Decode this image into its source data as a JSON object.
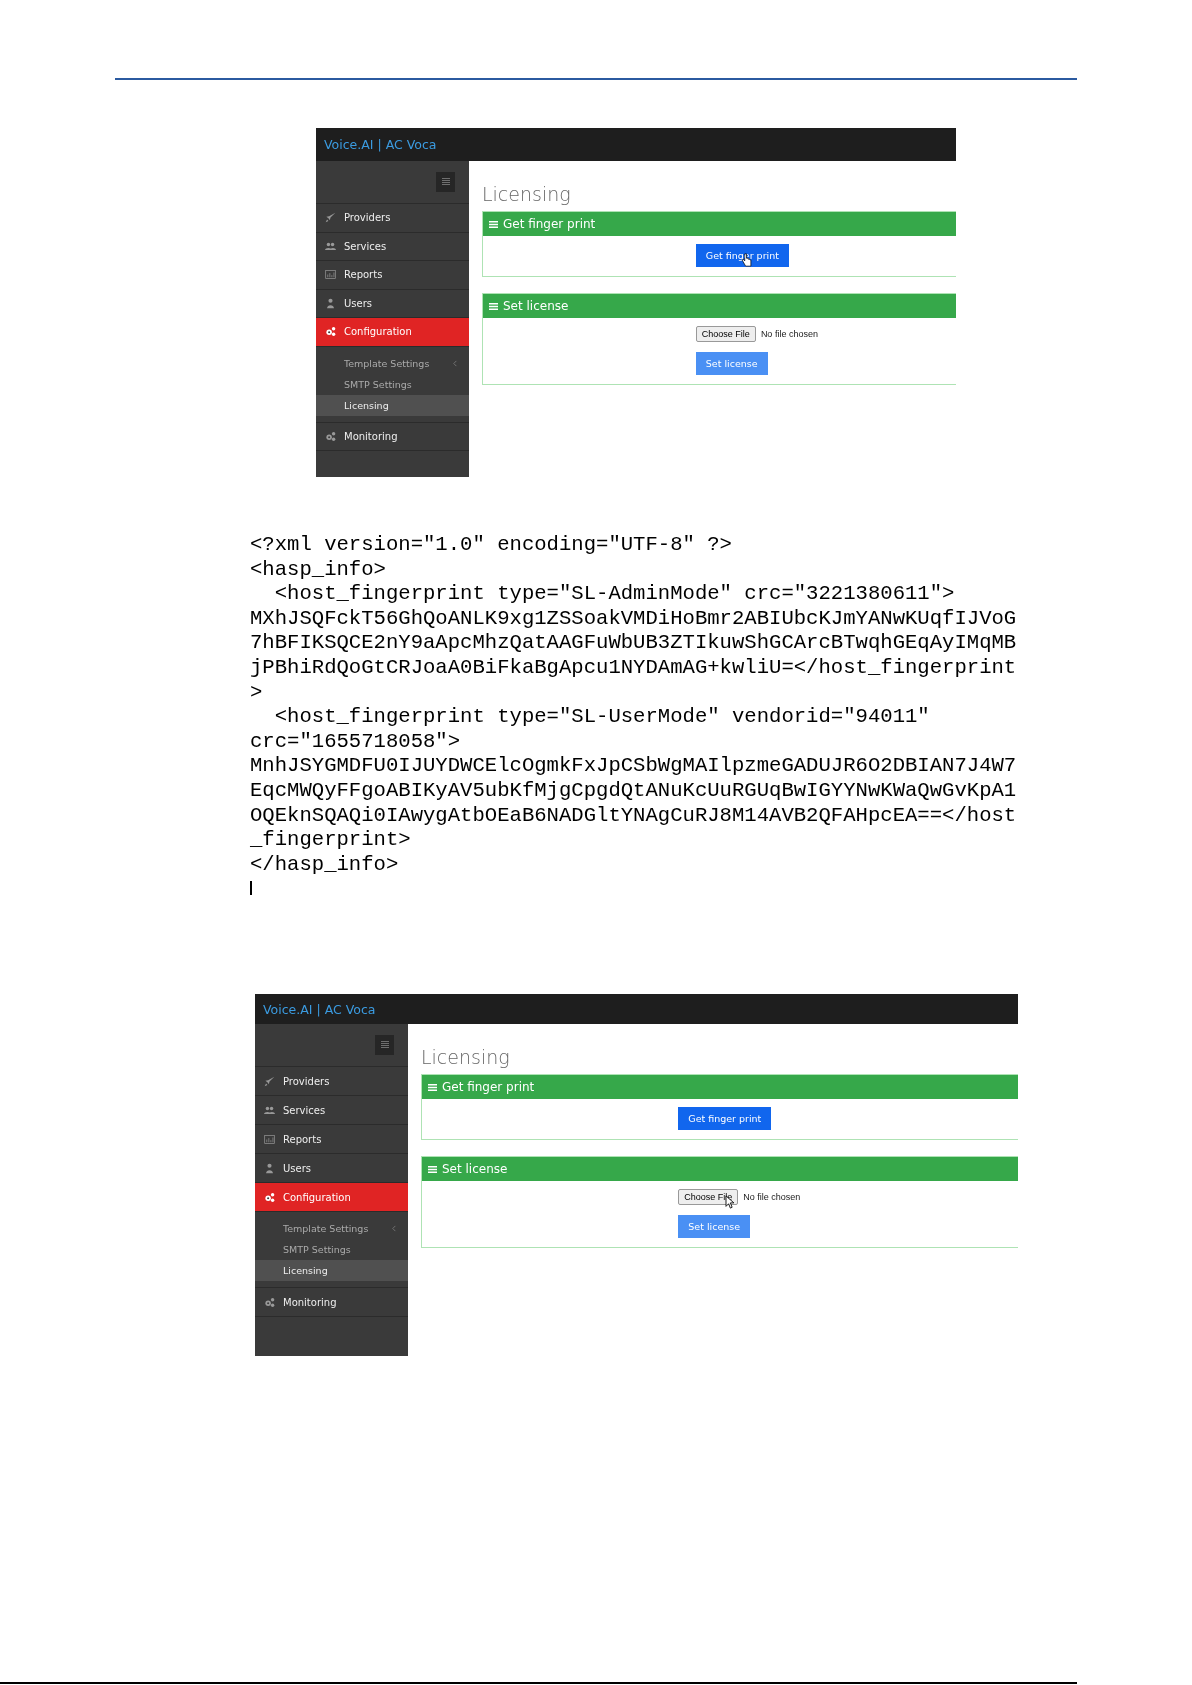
{
  "screenshots": [
    {
      "brand": "Voice.AI | AC Voca",
      "nav": [
        {
          "label": "Providers",
          "kind": "rocket",
          "selected": false
        },
        {
          "label": "Services",
          "kind": "people",
          "selected": false
        },
        {
          "label": "Reports",
          "kind": "chart",
          "selected": false
        },
        {
          "label": "Users",
          "kind": "user",
          "selected": false
        },
        {
          "label": "Configuration",
          "kind": "gears",
          "selected": true,
          "children": [
            {
              "label": "Template Settings",
              "expandable": true,
              "selected": false
            },
            {
              "label": "SMTP Settings",
              "selected": false
            },
            {
              "label": "Licensing",
              "selected": true
            }
          ]
        },
        {
          "label": "Monitoring",
          "kind": "gears",
          "selected": false
        }
      ],
      "page_title": "Licensing",
      "panels": [
        {
          "title": "Get finger print",
          "kind": "button",
          "button": "Get finger print",
          "hovered": true
        },
        {
          "title": "Set license",
          "kind": "file",
          "file_button": "Choose File",
          "file_status": "No file chosen",
          "button": "Set license"
        }
      ]
    },
    {
      "brand": "Voice.AI | AC Voca",
      "nav": [
        {
          "label": "Providers",
          "kind": "rocket",
          "selected": false
        },
        {
          "label": "Services",
          "kind": "people",
          "selected": false
        },
        {
          "label": "Reports",
          "kind": "chart",
          "selected": false
        },
        {
          "label": "Users",
          "kind": "user",
          "selected": false
        },
        {
          "label": "Configuration",
          "kind": "gears",
          "selected": true,
          "children": [
            {
              "label": "Template Settings",
              "expandable": true,
              "selected": false
            },
            {
              "label": "SMTP Settings",
              "selected": false
            },
            {
              "label": "Licensing",
              "selected": true
            }
          ]
        },
        {
          "label": "Monitoring",
          "kind": "gears",
          "selected": false
        }
      ],
      "page_title": "Licensing",
      "panels": [
        {
          "title": "Get finger print",
          "kind": "button",
          "button": "Get finger print"
        },
        {
          "title": "Set license",
          "kind": "file",
          "file_button": "Choose File",
          "file_status": "No file chosen",
          "button": "Set license",
          "file_hovered": true
        }
      ]
    }
  ],
  "code_lines": [
    "<?xml version=\"1.0\" encoding=\"UTF-8\" ?>",
    "<hasp_info>",
    "  <host_fingerprint type=\"SL-AdminMode\" crc=\"3221380611\">",
    "MXhJSQFckT56GhQoANLK9xg1ZSSoakVMDiHoBmr2ABIUbcKJmYANwKUqfIJVoG",
    "7hBFIKSQCE2nY9aApcMhzQatAAGFuWbUB3ZTIkuwShGCArcBTwqhGEqAyIMqMB",
    "jPBhiRdQoGtCRJoaA0BiFkaBgApcu1NYDAmAG+kwliU=</host_fingerprint",
    ">",
    "  <host_fingerprint type=\"SL-UserMode\" vendorid=\"94011\"",
    "crc=\"1655718058\">",
    "MnhJSYGMDFU0IJUYDWCElcOgmkFxJpCSbWgMAIlpzmeGADUJR6O2DBIAN7J4W7",
    "EqcMWQyFFgoABIKyAV5ubKfMjgCpgdQtANuKcUuRGUqBwIGYYNwKWaQwGvKpA1",
    "OQEknSQAQi0IAwygAtbOEaB6NADGltYNAgCuRJ8M14AVB2QFAHpcEA==</host",
    "_fingerprint>",
    "</hasp_info>"
  ]
}
